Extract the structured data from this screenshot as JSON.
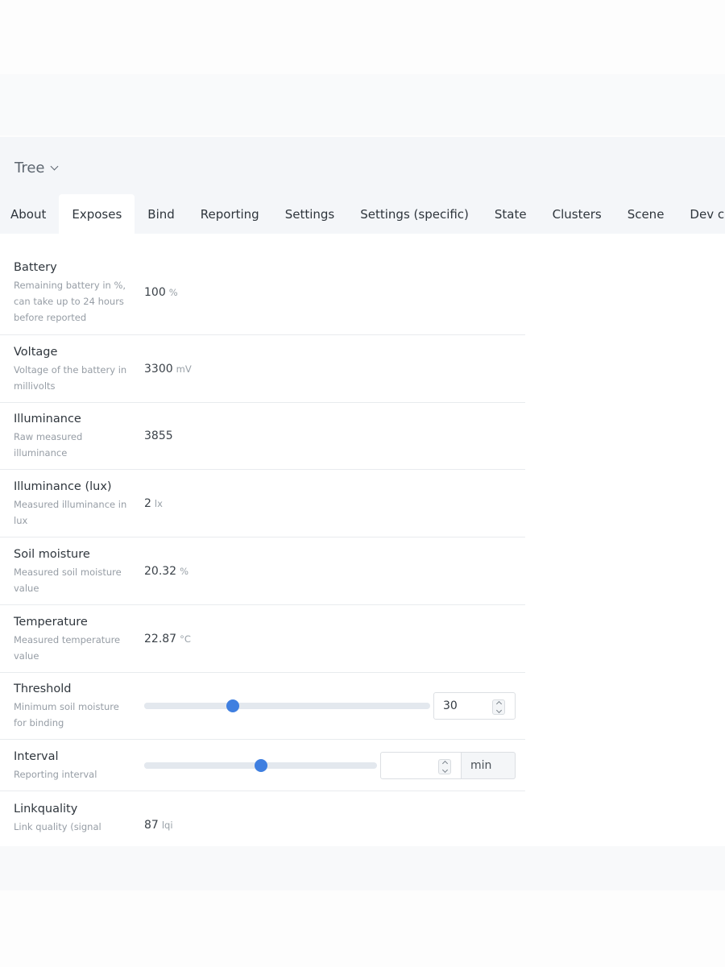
{
  "device": {
    "name": "Tree"
  },
  "tabs": [
    {
      "label": "About",
      "active": false
    },
    {
      "label": "Exposes",
      "active": true
    },
    {
      "label": "Bind",
      "active": false
    },
    {
      "label": "Reporting",
      "active": false
    },
    {
      "label": "Settings",
      "active": false
    },
    {
      "label": "Settings (specific)",
      "active": false
    },
    {
      "label": "State",
      "active": false
    },
    {
      "label": "Clusters",
      "active": false
    },
    {
      "label": "Scene",
      "active": false
    },
    {
      "label": "Dev console",
      "active": false
    }
  ],
  "exposes": {
    "battery": {
      "name": "Battery",
      "description": "Remaining battery in %, can take up to 24 hours before reported",
      "value": "100",
      "unit": "%"
    },
    "voltage": {
      "name": "Voltage",
      "description": "Voltage of the battery in millivolts",
      "value": "3300",
      "unit": "mV"
    },
    "illuminance": {
      "name": "Illuminance",
      "description": "Raw measured illuminance",
      "value": "3855"
    },
    "illuminance_lux": {
      "name": "Illuminance (lux)",
      "description": "Measured illuminance in lux",
      "value": "2",
      "unit": "lx"
    },
    "soil_moisture": {
      "name": "Soil moisture",
      "description": "Measured soil moisture value",
      "value": "20.32",
      "unit": "%"
    },
    "temperature": {
      "name": "Temperature",
      "description": "Measured temperature value",
      "value": "22.87",
      "unit": "°C"
    },
    "threshold": {
      "name": "Threshold",
      "description": "Minimum soil moisture for binding",
      "value": "30",
      "slider_fraction": 0.31
    },
    "interval": {
      "name": "Interval",
      "description": "Reporting interval",
      "value": "",
      "unit": "min",
      "slider_fraction": 0.5
    },
    "linkquality": {
      "name": "Linkquality",
      "description": "Link quality (signal",
      "value": "87",
      "unit": "lqi"
    }
  },
  "colors": {
    "accent": "#3f7fe0",
    "header_bg": "#f4f6f9",
    "divider": "#e8ebee"
  }
}
